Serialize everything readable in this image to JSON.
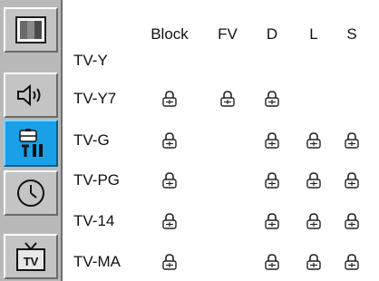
{
  "sidebar": {
    "items": [
      {
        "name": "picture",
        "icon": "picture-icon"
      },
      {
        "name": "sound",
        "icon": "speaker-icon"
      },
      {
        "name": "setup",
        "icon": "toolbox-icon",
        "active": true
      },
      {
        "name": "time",
        "icon": "clock-icon"
      },
      {
        "name": "tv",
        "icon": "tv-icon",
        "label": "TV"
      }
    ]
  },
  "table": {
    "columns": [
      "Block",
      "FV",
      "D",
      "L",
      "S"
    ],
    "rows": [
      {
        "label": "TV-Y",
        "locks": [
          false,
          false,
          false,
          false,
          false
        ]
      },
      {
        "label": "TV-Y7",
        "locks": [
          true,
          true,
          true,
          false,
          false
        ]
      },
      {
        "label": "TV-G",
        "locks": [
          true,
          false,
          true,
          true,
          true
        ]
      },
      {
        "label": "TV-PG",
        "locks": [
          true,
          false,
          true,
          true,
          true
        ]
      },
      {
        "label": "TV-14",
        "locks": [
          true,
          false,
          true,
          true,
          true
        ]
      },
      {
        "label": "TV-MA",
        "locks": [
          true,
          false,
          true,
          true,
          true
        ]
      }
    ]
  },
  "colors": {
    "sidebar_bg": "#b9b9b9",
    "active_item": "#1aa0e6",
    "text": "#111111"
  }
}
